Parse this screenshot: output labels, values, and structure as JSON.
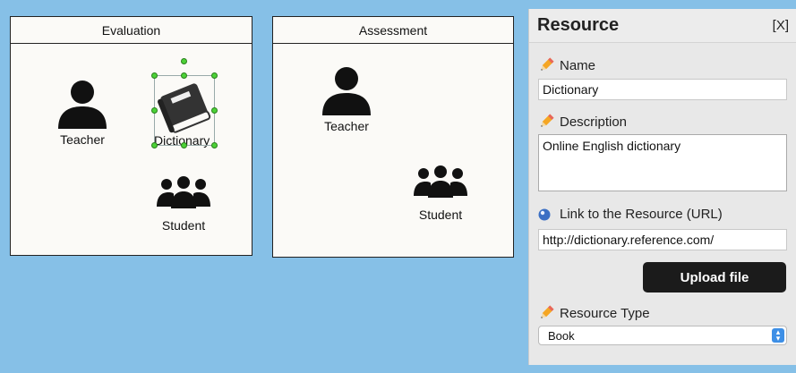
{
  "canvas": {
    "pools": [
      {
        "title": "Evaluation",
        "actors": [
          {
            "label": "Teacher",
            "icon": "person-icon"
          },
          {
            "label": "Dictionary",
            "icon": "book-icon"
          },
          {
            "label": "Student",
            "icon": "group-icon"
          }
        ]
      },
      {
        "title": "Assessment",
        "actors": [
          {
            "label": "Teacher",
            "icon": "person-icon"
          },
          {
            "label": "Student",
            "icon": "group-icon"
          }
        ]
      }
    ]
  },
  "panel": {
    "title": "Resource",
    "close_label": "[X]",
    "name_label": "Name",
    "name_value": "Dictionary",
    "description_label": "Description",
    "description_value": "Online English dictionary",
    "url_label": "Link to the Resource (URL)",
    "url_value": "http://dictionary.reference.com/",
    "upload_label": "Upload file",
    "type_label": "Resource Type",
    "type_value": "Book"
  },
  "colors": {
    "background": "#86c0e7",
    "pool_fill": "#fbfaf7",
    "handle": "#4cd137",
    "button": "#1b1b1b",
    "select_arrow": "#3d8fe6"
  }
}
